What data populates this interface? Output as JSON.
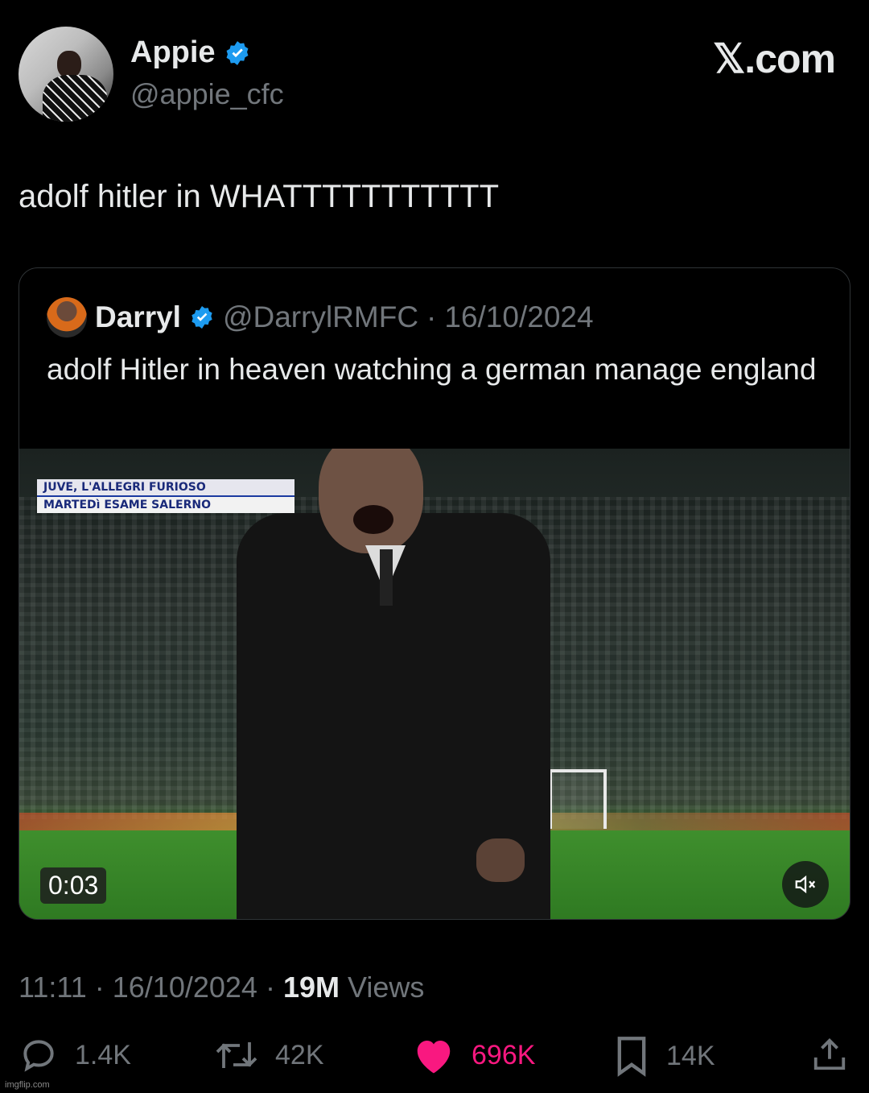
{
  "author": {
    "name": "Appie",
    "handle": "@appie_cfc",
    "verified": true
  },
  "brand": "𝕏.com",
  "tweet_text": "adolf hitler in WHATTTTTTTTTTT",
  "quoted": {
    "name": "Darryl",
    "handle": "@DarrylRMFC",
    "date": "16/10/2024",
    "text": "adolf Hitler in heaven watching a german manage england",
    "video": {
      "banner_line1": "JUVE, L'ALLEGRI FURIOSO",
      "banner_line2": "MARTEDì ESAME SALERNO",
      "timestamp": "0:03",
      "mute_icon": "speaker-mute-icon"
    }
  },
  "meta": {
    "time": "11:11",
    "date": "16/10/2024",
    "views_count": "19M",
    "views_label": "Views"
  },
  "actions": {
    "replies": "1.4K",
    "reposts": "42K",
    "likes": "696K",
    "bookmarks": "14K"
  },
  "colors": {
    "verified": "#1d9bf0",
    "like": "#f91880",
    "muted_text": "#71767b"
  },
  "watermark": "imgflip.com"
}
